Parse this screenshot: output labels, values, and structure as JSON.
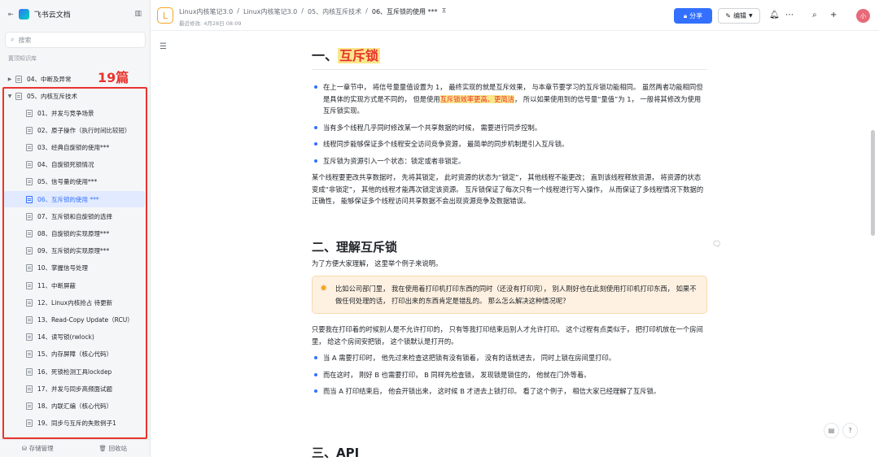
{
  "sidebar": {
    "app_title": "飞书云文档",
    "search_placeholder": "搜索",
    "kb_label": "置顶知识库",
    "annotation": "19篇",
    "parent_items": [
      {
        "label": "04、中断及异常"
      },
      {
        "label": "05、内核互斥技术"
      }
    ],
    "children": [
      {
        "label": "01、并发与竞争场景"
      },
      {
        "label": "02、原子操作（执行时间比较短）"
      },
      {
        "label": "03、经典自旋锁的使用***"
      },
      {
        "label": "04、自旋锁死锁情况"
      },
      {
        "label": "05、信号量的使用***"
      },
      {
        "label": "06、互斥锁的使用 ***"
      },
      {
        "label": "07、互斥锁和自旋锁的选择"
      },
      {
        "label": "08、自旋锁的实现原理***"
      },
      {
        "label": "09、互斥锁的实现原理***"
      },
      {
        "label": "10、掌握信号处理"
      },
      {
        "label": "11、中断屏蔽"
      },
      {
        "label": "12、Linux内核抢占 待更新"
      },
      {
        "label": "13、Read-Copy Update（RCU）"
      },
      {
        "label": "14、读写锁(rwlock)"
      },
      {
        "label": "15、内存屏障（核心代码）"
      },
      {
        "label": "16、死锁检测工具lockdep"
      },
      {
        "label": "17、并发与同步高频面试题"
      },
      {
        "label": "18、内联汇编（核心代码）"
      },
      {
        "label": "19、同步与互斥的失败例子1"
      }
    ],
    "footer": {
      "storage": "存储管理",
      "trash": "回收站"
    }
  },
  "header": {
    "doc_icon_letter": "L",
    "crumbs": [
      "Linux内核笔记3.0",
      "Linux内核笔记3.0",
      "05、内核互斥技术",
      "06、互斥锁的使用 ***"
    ],
    "modified": "最近修改: 4月28日 08:09",
    "share_label": "分享",
    "edit_label": "编辑",
    "avatar_text": "小"
  },
  "doc": {
    "h1_prefix": "一、",
    "h1_highlight": "互斥锁",
    "b1_a": "在上一章节中， 将信号量量值设置为 1， 最终实现的就是互斥效果， 与本章节要学习的互斥锁功能相同。 虽然两者功能相同但是具体的实现方式是不同的， 但是使用",
    "b1_mark": "互斥锁效率更高、更简洁",
    "b1_b": "， 所以如果使用到的信号量“量值”为 1， 一般将其修改为使用互斥锁实现。",
    "b2": "当有多个线程几乎同时修改某一个共享数据的时候， 需要进行同步控制。",
    "b3": "线程同步能够保证多个线程安全访问竞争资源， 最简单的同步机制是引入互斥锁。",
    "b4": "互斥锁为资源引入一个状态：锁定或者非锁定。",
    "p1": "某个线程要更改共享数据时， 先将其锁定， 此时资源的状态为“锁定”， 其他线程不能更改； 直到该线程释放资源， 将资源的状态变成“非锁定”， 其他的线程才能再次锁定该资源。 互斥锁保证了每次只有一个线程进行写入操作， 从而保证了多线程情况下数据的正确性， 能够保证多个线程访问共享数据不会出现资源竞争及数据错误。",
    "h2": "二、理解互斥锁",
    "p2": "为了方便大家理解， 这里举个例子来说明。",
    "callout": "比如公司部门里， 我在使用着打印机打印东西的同时（还没有打印完）， 别人刚好也在此刻使用打印机打印东西， 如果不做任何处理的话， 打印出来的东西肯定是错乱的。 那么怎么解决这种情况呢？",
    "p3": "只要我在打印着的时候别人是不允许打印的， 只有等我打印结束后别人才允许打印。 这个过程有点类似于， 把打印机放在一个房间里， 给这个房间安把锁， 这个锁默认是打开的。",
    "b5": "当 A 需要打印时， 他先过来检查这把锁有没有锁着， 没有的话就进去， 同时上锁在房间里打印。",
    "b6": "而在这时， 刚好 B 也需要打印， B 同样先检查锁， 发现锁是锁住的， 他就在门外等着。",
    "b7": "而当 A 打印结束后， 他会开锁出来， 这时候 B 才进去上锁打印。 看了这个例子， 相信大家已经理解了互斥锁。",
    "h3": "三、API"
  },
  "icons": {
    "accent": "#3370ff",
    "annotation_color": "#e8342e"
  }
}
